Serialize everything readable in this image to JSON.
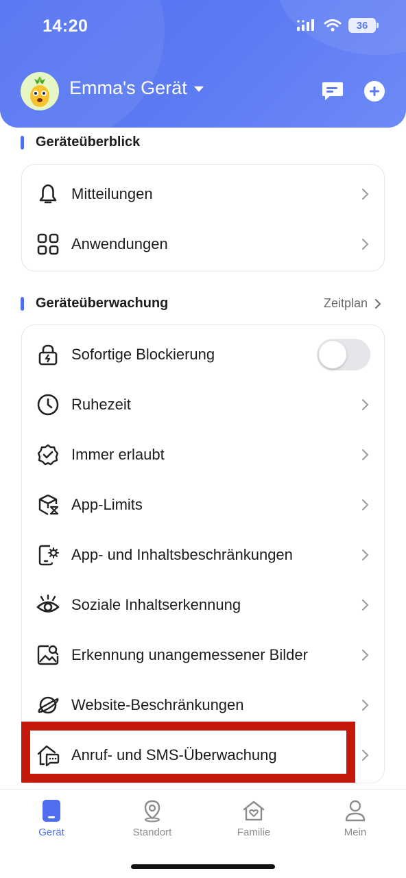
{
  "status_bar": {
    "time": "14:20",
    "battery": "36"
  },
  "header": {
    "device_name": "Emma's Gerät"
  },
  "overview": {
    "title": "Geräteüberblick",
    "items": [
      {
        "label": "Mitteilungen",
        "icon": "bell-icon"
      },
      {
        "label": "Anwendungen",
        "icon": "apps-grid-icon"
      }
    ]
  },
  "monitoring": {
    "title": "Geräteüberwachung",
    "link": "Zeitplan",
    "items": [
      {
        "label": "Sofortige Blockierung",
        "icon": "lock-bolt-icon",
        "toggle": false
      },
      {
        "label": "Ruhezeit",
        "icon": "clock-icon"
      },
      {
        "label": "Immer erlaubt",
        "icon": "badge-check-icon"
      },
      {
        "label": "App-Limits",
        "icon": "cube-hourglass-icon"
      },
      {
        "label": "App- und Inhaltsbeschränkungen",
        "icon": "phone-gear-icon"
      },
      {
        "label": "Soziale Inhaltserkennung",
        "icon": "eye-icon"
      },
      {
        "label": "Erkennung unangemessener Bilder",
        "icon": "image-search-icon"
      },
      {
        "label": "Website-Beschränkungen",
        "icon": "planet-icon"
      },
      {
        "label": "Anruf- und SMS-Überwachung",
        "icon": "home-chat-icon"
      }
    ]
  },
  "tabbar": {
    "active": "Gerät",
    "tabs": [
      {
        "label": "Gerät",
        "icon": "device-icon"
      },
      {
        "label": "Standort",
        "icon": "location-pin-icon"
      },
      {
        "label": "Familie",
        "icon": "family-house-icon"
      },
      {
        "label": "Mein",
        "icon": "profile-icon"
      }
    ]
  },
  "colors": {
    "accent": "#4f6ff0",
    "highlight": "#c4180b",
    "toggle_off": "#e5e5ea"
  }
}
